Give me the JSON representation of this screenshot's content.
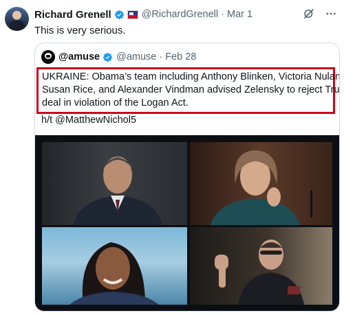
{
  "tweet": {
    "author_name": "Richard Grenell",
    "author_handle": "@RichardGrenell",
    "separator": "·",
    "date": "Mar 1",
    "text": "This is very serious."
  },
  "quoted": {
    "author_name": "@amuse",
    "author_handle": "@amuse",
    "separator": "·",
    "date": "Feb 28",
    "body_lines": [
      "UKRAINE: Obama’s team including Anthony Blinken, Victoria Nuland,",
      "Susan Rice, and Alexander Vindman advised Zelensky to reject Trump’s",
      "deal in violation of the Logan Act."
    ],
    "hat_tip": "h/t @MatthewNichol5"
  },
  "colors": {
    "verified_blue": "#1d9bf0",
    "highlight_box": "#d0021b",
    "secondary_text": "#536471"
  },
  "icons": [
    "verified-badge-icon",
    "flag-badge-icon",
    "grok-icon",
    "more-icon"
  ]
}
